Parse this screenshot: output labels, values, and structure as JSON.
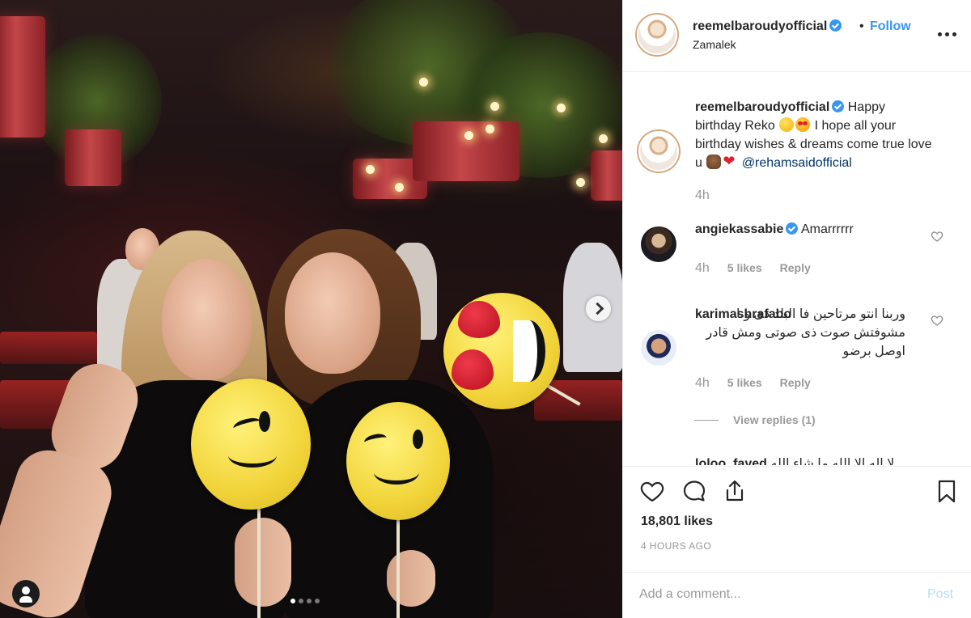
{
  "post": {
    "username": "reemelbaroudyofficial",
    "location": "Zamalek",
    "follow_label": "Follow",
    "separator": "•"
  },
  "caption": {
    "username": "reemelbaroudyofficial",
    "text_1": "Happy birthday Reko",
    "text_2": "I hope all your birthday wishes & dreams come true love u",
    "mention": "@rehamsaidofficial",
    "time": "4h"
  },
  "comments": [
    {
      "username": "angiekassabie",
      "text": "Amarrrrrr",
      "time": "4h",
      "likes": "5 likes",
      "reply": "Reply"
    },
    {
      "username": "karimashrafabo",
      "text": "وربنا انتو مرتاحين فا البلد دى ونا مشوفتش صوت ذى صوتى ومش قادر اوصل برضو",
      "time": "4h",
      "likes": "5 likes",
      "reply": "Reply",
      "view_replies": "View replies (1)"
    },
    {
      "username": "loloo_fayed",
      "text": "لا اله الا الله ما شاء الله يحفظكم"
    }
  ],
  "stats": {
    "likes": "18,801 likes",
    "time_ago": "4 HOURS AGO"
  },
  "composer": {
    "placeholder": "Add a comment...",
    "post_label": "Post"
  },
  "carousel": {
    "total": 4,
    "active_index": 0
  },
  "icons": {
    "verified": "verified-badge-icon",
    "like": "heart-icon",
    "comment": "comment-bubble-icon",
    "share": "share-icon",
    "save": "bookmark-icon",
    "more": "more-options-icon",
    "tag": "user-tag-icon",
    "next": "chevron-right-icon"
  },
  "colors": {
    "accent": "#3897f0",
    "muted": "#999999",
    "post_disabled": "#b2dffc"
  }
}
